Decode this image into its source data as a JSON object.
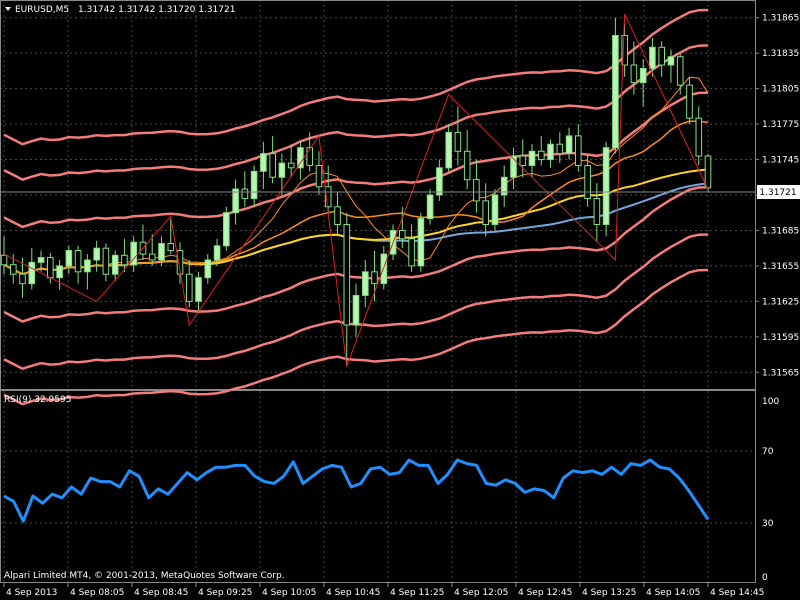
{
  "header": {
    "symbol_label": "EURUSD,M5",
    "ohlc_label": "1.31742 1.31742 1.31720 1.31721"
  },
  "copyright": "Alpari Limited MT4, © 2001-2013, MetaQuotes Software Corp.",
  "colors": {
    "background": "#000000",
    "grid": "#4a4a4a",
    "bull_candle": "#b8f5b0",
    "bear_candle": "#000000",
    "candle_outline": "#7fe07f",
    "zigzag": "#e02020",
    "envelope": "#f47c7c",
    "ma_fast": "#ff8c1a",
    "ma_slow": "#ffd21a",
    "ma_long": "#6fa8dc",
    "rsi": "#1e90ff"
  },
  "price_axis": {
    "labels": [
      "1.31865",
      "1.31835",
      "1.31805",
      "1.31775",
      "1.31745",
      "1.31715",
      "1.31685",
      "1.31655",
      "1.31625",
      "1.31595",
      "1.31565"
    ],
    "current_price": "1.31721"
  },
  "rsi_panel": {
    "title": "RSI(9) 32.9595",
    "levels": [
      "100",
      "70",
      "30",
      "0"
    ]
  },
  "time_axis": {
    "labels": [
      "4 Sep 2013",
      "4 Sep 08:05",
      "4 Sep 08:45",
      "4 Sep 09:25",
      "4 Sep 10:05",
      "4 Sep 10:45",
      "4 Sep 11:25",
      "4 Sep 12:05",
      "4 Sep 12:45",
      "4 Sep 13:25",
      "4 Sep 14:05",
      "4 Sep 14:45"
    ]
  },
  "chart_data": {
    "type": "candlestick",
    "symbol": "EURUSD",
    "timeframe": "M5",
    "ylim": [
      1.3155,
      1.3188
    ],
    "candles": [
      {
        "o": 1.31664,
        "h": 1.3168,
        "l": 1.31648,
        "c": 1.31656
      },
      {
        "o": 1.31656,
        "h": 1.31665,
        "l": 1.3164,
        "c": 1.31648
      },
      {
        "o": 1.31648,
        "h": 1.31662,
        "l": 1.31628,
        "c": 1.3164
      },
      {
        "o": 1.3164,
        "h": 1.3167,
        "l": 1.31635,
        "c": 1.31658
      },
      {
        "o": 1.31658,
        "h": 1.31668,
        "l": 1.3165,
        "c": 1.31662
      },
      {
        "o": 1.31662,
        "h": 1.31666,
        "l": 1.3164,
        "c": 1.31645
      },
      {
        "o": 1.31645,
        "h": 1.3166,
        "l": 1.31635,
        "c": 1.31655
      },
      {
        "o": 1.31655,
        "h": 1.31672,
        "l": 1.31648,
        "c": 1.31668
      },
      {
        "o": 1.31668,
        "h": 1.31672,
        "l": 1.3164,
        "c": 1.3165
      },
      {
        "o": 1.3165,
        "h": 1.31665,
        "l": 1.31635,
        "c": 1.3166
      },
      {
        "o": 1.3166,
        "h": 1.31676,
        "l": 1.3165,
        "c": 1.3167
      },
      {
        "o": 1.3167,
        "h": 1.31674,
        "l": 1.31642,
        "c": 1.31648
      },
      {
        "o": 1.31648,
        "h": 1.31668,
        "l": 1.31642,
        "c": 1.31664
      },
      {
        "o": 1.31664,
        "h": 1.31678,
        "l": 1.3165,
        "c": 1.31656
      },
      {
        "o": 1.31656,
        "h": 1.3168,
        "l": 1.3165,
        "c": 1.31675
      },
      {
        "o": 1.31675,
        "h": 1.3169,
        "l": 1.3166,
        "c": 1.31665
      },
      {
        "o": 1.31665,
        "h": 1.31682,
        "l": 1.31655,
        "c": 1.3166
      },
      {
        "o": 1.3166,
        "h": 1.3168,
        "l": 1.31655,
        "c": 1.31674
      },
      {
        "o": 1.31674,
        "h": 1.31695,
        "l": 1.31665,
        "c": 1.31668
      },
      {
        "o": 1.31668,
        "h": 1.31675,
        "l": 1.3164,
        "c": 1.31648
      },
      {
        "o": 1.31648,
        "h": 1.3166,
        "l": 1.3162,
        "c": 1.31625
      },
      {
        "o": 1.31625,
        "h": 1.3165,
        "l": 1.31615,
        "c": 1.31645
      },
      {
        "o": 1.31645,
        "h": 1.31665,
        "l": 1.3164,
        "c": 1.3166
      },
      {
        "o": 1.3166,
        "h": 1.31678,
        "l": 1.31655,
        "c": 1.31672
      },
      {
        "o": 1.31672,
        "h": 1.31705,
        "l": 1.31668,
        "c": 1.317
      },
      {
        "o": 1.317,
        "h": 1.31728,
        "l": 1.3169,
        "c": 1.3172
      },
      {
        "o": 1.3172,
        "h": 1.31735,
        "l": 1.31705,
        "c": 1.31712
      },
      {
        "o": 1.31712,
        "h": 1.3174,
        "l": 1.31705,
        "c": 1.31735
      },
      {
        "o": 1.31735,
        "h": 1.3176,
        "l": 1.3172,
        "c": 1.3175
      },
      {
        "o": 1.3175,
        "h": 1.31765,
        "l": 1.31725,
        "c": 1.3173
      },
      {
        "o": 1.3173,
        "h": 1.3175,
        "l": 1.31715,
        "c": 1.31742
      },
      {
        "o": 1.31742,
        "h": 1.31758,
        "l": 1.3173,
        "c": 1.31738
      },
      {
        "o": 1.31738,
        "h": 1.3176,
        "l": 1.31728,
        "c": 1.31755
      },
      {
        "o": 1.31755,
        "h": 1.31768,
        "l": 1.31735,
        "c": 1.3174
      },
      {
        "o": 1.3174,
        "h": 1.31752,
        "l": 1.31715,
        "c": 1.31722
      },
      {
        "o": 1.31722,
        "h": 1.3174,
        "l": 1.317,
        "c": 1.31705
      },
      {
        "o": 1.31705,
        "h": 1.31718,
        "l": 1.3168,
        "c": 1.3169
      },
      {
        "o": 1.3169,
        "h": 1.317,
        "l": 1.3157,
        "c": 1.31605
      },
      {
        "o": 1.31605,
        "h": 1.3164,
        "l": 1.31595,
        "c": 1.3163
      },
      {
        "o": 1.3163,
        "h": 1.3166,
        "l": 1.3162,
        "c": 1.3165
      },
      {
        "o": 1.3165,
        "h": 1.31668,
        "l": 1.31625,
        "c": 1.3164
      },
      {
        "o": 1.3164,
        "h": 1.31672,
        "l": 1.31635,
        "c": 1.31665
      },
      {
        "o": 1.31665,
        "h": 1.3169,
        "l": 1.3166,
        "c": 1.31685
      },
      {
        "o": 1.31685,
        "h": 1.31705,
        "l": 1.3167,
        "c": 1.31678
      },
      {
        "o": 1.31678,
        "h": 1.3169,
        "l": 1.3165,
        "c": 1.31655
      },
      {
        "o": 1.31655,
        "h": 1.317,
        "l": 1.3165,
        "c": 1.31695
      },
      {
        "o": 1.31695,
        "h": 1.3172,
        "l": 1.3169,
        "c": 1.31715
      },
      {
        "o": 1.31715,
        "h": 1.31745,
        "l": 1.3171,
        "c": 1.31738
      },
      {
        "o": 1.31738,
        "h": 1.31775,
        "l": 1.31735,
        "c": 1.31768
      },
      {
        "o": 1.31768,
        "h": 1.3179,
        "l": 1.3174,
        "c": 1.31752
      },
      {
        "o": 1.31752,
        "h": 1.3177,
        "l": 1.3172,
        "c": 1.31728
      },
      {
        "o": 1.31728,
        "h": 1.31745,
        "l": 1.317,
        "c": 1.3171
      },
      {
        "o": 1.3171,
        "h": 1.31725,
        "l": 1.3168,
        "c": 1.3169
      },
      {
        "o": 1.3169,
        "h": 1.3172,
        "l": 1.31685,
        "c": 1.31715
      },
      {
        "o": 1.31715,
        "h": 1.3174,
        "l": 1.31705,
        "c": 1.3173
      },
      {
        "o": 1.3173,
        "h": 1.31755,
        "l": 1.3172,
        "c": 1.31748
      },
      {
        "o": 1.31748,
        "h": 1.31762,
        "l": 1.3173,
        "c": 1.3174
      },
      {
        "o": 1.3174,
        "h": 1.31758,
        "l": 1.3173,
        "c": 1.31752
      },
      {
        "o": 1.31752,
        "h": 1.31765,
        "l": 1.3174,
        "c": 1.31745
      },
      {
        "o": 1.31745,
        "h": 1.31762,
        "l": 1.31738,
        "c": 1.31758
      },
      {
        "o": 1.31758,
        "h": 1.31768,
        "l": 1.31742,
        "c": 1.3175
      },
      {
        "o": 1.3175,
        "h": 1.31772,
        "l": 1.31745,
        "c": 1.31765
      },
      {
        "o": 1.31765,
        "h": 1.31775,
        "l": 1.31735,
        "c": 1.3174
      },
      {
        "o": 1.3174,
        "h": 1.3175,
        "l": 1.31705,
        "c": 1.31712
      },
      {
        "o": 1.31712,
        "h": 1.31725,
        "l": 1.31675,
        "c": 1.3169
      },
      {
        "o": 1.3169,
        "h": 1.3176,
        "l": 1.3168,
        "c": 1.31755
      },
      {
        "o": 1.31755,
        "h": 1.31865,
        "l": 1.3175,
        "c": 1.3185
      },
      {
        "o": 1.3185,
        "h": 1.3186,
        "l": 1.31815,
        "c": 1.31825
      },
      {
        "o": 1.31825,
        "h": 1.31845,
        "l": 1.318,
        "c": 1.3181
      },
      {
        "o": 1.3181,
        "h": 1.3183,
        "l": 1.3179,
        "c": 1.31822
      },
      {
        "o": 1.31822,
        "h": 1.31848,
        "l": 1.31815,
        "c": 1.3184
      },
      {
        "o": 1.3184,
        "h": 1.31845,
        "l": 1.31815,
        "c": 1.31825
      },
      {
        "o": 1.31825,
        "h": 1.31838,
        "l": 1.3181,
        "c": 1.31832
      },
      {
        "o": 1.31832,
        "h": 1.31835,
        "l": 1.318,
        "c": 1.31808
      },
      {
        "o": 1.31808,
        "h": 1.31815,
        "l": 1.31775,
        "c": 1.3178
      },
      {
        "o": 1.3178,
        "h": 1.3179,
        "l": 1.3174,
        "c": 1.31748
      },
      {
        "o": 1.31748,
        "h": 1.3175,
        "l": 1.31718,
        "c": 1.31721
      }
    ],
    "zigzag": [
      {
        "i": 0,
        "p": 1.31665
      },
      {
        "i": 10,
        "p": 1.31625
      },
      {
        "i": 18,
        "p": 1.31697
      },
      {
        "i": 20,
        "p": 1.31605
      },
      {
        "i": 34,
        "p": 1.31765
      },
      {
        "i": 37,
        "p": 1.3157
      },
      {
        "i": 48,
        "p": 1.318
      },
      {
        "i": 66,
        "p": 1.3166
      },
      {
        "i": 67,
        "p": 1.31868
      },
      {
        "i": 76,
        "p": 1.3172
      }
    ],
    "rsi": [
      45,
      42,
      31,
      45,
      41,
      46,
      44,
      50,
      46,
      55,
      53,
      53,
      50,
      59,
      56,
      44,
      49,
      46,
      52,
      58,
      54,
      58,
      61,
      61,
      62,
      62,
      56,
      53,
      52,
      56,
      64,
      52,
      56,
      60,
      62,
      61,
      50,
      52,
      60,
      61,
      57,
      58,
      65,
      62,
      62,
      52,
      57,
      65,
      63,
      62,
      52,
      51,
      54,
      52,
      47,
      49,
      48,
      44,
      55,
      59,
      58,
      59,
      57,
      61,
      57,
      63,
      62,
      65,
      61,
      60,
      55,
      48,
      40,
      32
    ],
    "rsi_value": 32.9595,
    "rsi_ylim": [
      0,
      100
    ]
  }
}
